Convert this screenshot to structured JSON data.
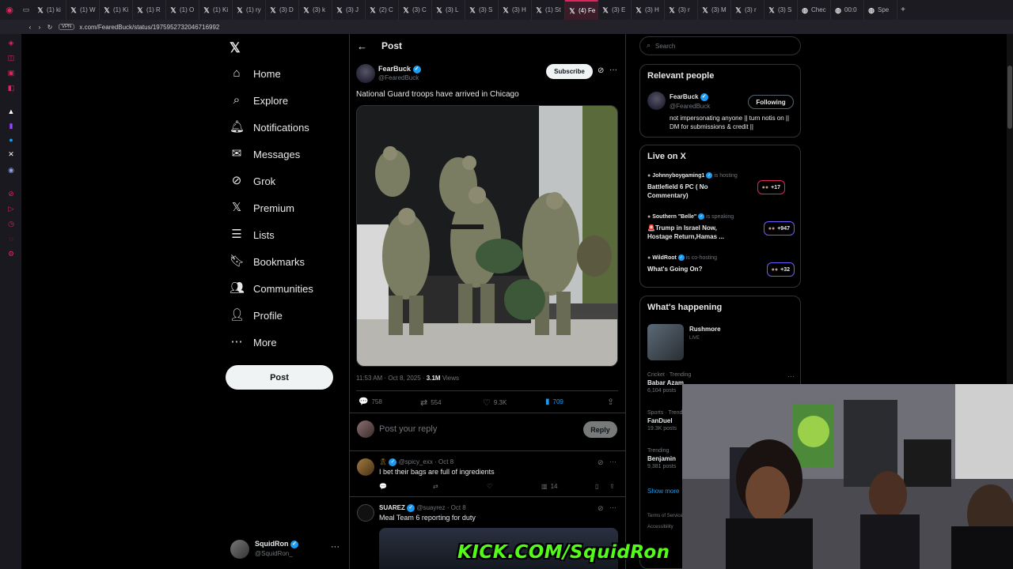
{
  "browser": {
    "tabs": [
      {
        "label": "(1) ki"
      },
      {
        "label": "(1) W"
      },
      {
        "label": "(1) Ki"
      },
      {
        "label": "(1) R"
      },
      {
        "label": "(1) O"
      },
      {
        "label": "(1) Ki"
      },
      {
        "label": "(1) ry"
      },
      {
        "label": "(3) D"
      },
      {
        "label": "(3) k"
      },
      {
        "label": "(3) J"
      },
      {
        "label": "(2) C"
      },
      {
        "label": "(3) C"
      },
      {
        "label": "(3) L"
      },
      {
        "label": "(3) S"
      },
      {
        "label": "(3) H"
      },
      {
        "label": "(1) St"
      },
      {
        "label": "(4) Fe"
      },
      {
        "label": "(3) E"
      },
      {
        "label": "(3) H"
      },
      {
        "label": "(3) r"
      },
      {
        "label": "(3) M"
      },
      {
        "label": "(3) r"
      },
      {
        "label": "(3) S"
      },
      {
        "label": "Chec"
      },
      {
        "label": "00:0"
      },
      {
        "label": "Spe"
      }
    ],
    "url": "x.com/FearedBuck/status/1975952732046716992",
    "vpn_label": "VPN"
  },
  "nav": {
    "items": [
      {
        "label": "Home",
        "icon": "home-icon"
      },
      {
        "label": "Explore",
        "icon": "search-icon"
      },
      {
        "label": "Notifications",
        "icon": "bell-icon"
      },
      {
        "label": "Messages",
        "icon": "mail-icon"
      },
      {
        "label": "Grok",
        "icon": "grok-icon"
      },
      {
        "label": "Premium",
        "icon": "x-logo-icon"
      },
      {
        "label": "Lists",
        "icon": "list-icon"
      },
      {
        "label": "Bookmarks",
        "icon": "bookmark-icon"
      },
      {
        "label": "Communities",
        "icon": "communities-icon"
      },
      {
        "label": "Profile",
        "icon": "person-icon"
      },
      {
        "label": "More",
        "icon": "more-circle-icon"
      }
    ],
    "post_button": "Post",
    "account": {
      "name": "SquidRon",
      "handle": "@SquidRon_"
    }
  },
  "main": {
    "header_title": "Post",
    "post": {
      "author": "FearBuck",
      "handle": "@FearedBuck",
      "subscribe": "Subscribe",
      "text": "National Guard troops have arrived in Chicago",
      "time": "11:53 AM · Oct 8, 2025 ·",
      "views_count": "3.1M",
      "views_label": "Views",
      "replies": "758",
      "reposts": "554",
      "likes": "9.3K",
      "bookmarks": "709"
    },
    "reply_placeholder": "Post your reply",
    "reply_button": "Reply",
    "replies": [
      {
        "handle": "@spicy_exx · Oct 8",
        "text": "I bet their bags are full of ingredients",
        "views": "14"
      },
      {
        "name": "SUAREZ",
        "handle": "@suayrez · Oct 8",
        "text": "Meal Team 6 reporting for duty"
      }
    ]
  },
  "right": {
    "search_placeholder": "Search",
    "relevant": {
      "title": "Relevant people",
      "name": "FearBuck",
      "handle": "@FearedBuck",
      "follow": "Following",
      "bio": "not impersonating anyone || turn notis on || DM for submissions & credit ||"
    },
    "live": {
      "title": "Live on X",
      "items": [
        {
          "host": "Johnnyboygaming1",
          "status": "is hosting",
          "title": "Battlefield 6 PC ( No Commentary)",
          "count": "+17"
        },
        {
          "host": "Southern \"Belle\"",
          "status": "is speaking",
          "title": "🚨Trump in Israel Now, Hostage Return,Hamas ...",
          "count": "+947"
        },
        {
          "host": "WildRoot",
          "status": "is co-hosting",
          "title": "What's Going On?",
          "count": "+32"
        }
      ]
    },
    "happening": {
      "title": "What's happening",
      "featured": {
        "title": "Rushmore",
        "sub": "LIVE"
      },
      "trends": [
        {
          "cat": "Cricket · Trending",
          "name": "Babar Azam",
          "posts": "6,104 posts"
        },
        {
          "cat": "Sports · Trending",
          "name": "FanDuel",
          "posts": "19.3K posts"
        },
        {
          "cat": "Trending",
          "name": "Benjamin",
          "posts": "9,381 posts"
        }
      ],
      "show_more": "Show more"
    },
    "footer": [
      "Terms of Service",
      "Accessibility"
    ]
  },
  "overlay": {
    "banner": "KICK.COM/SquidRon"
  },
  "colors": {
    "accent": "#1d9bf0",
    "bg": "#000000",
    "border": "#2f3336",
    "muted": "#71767b",
    "kick": "#53fc18"
  }
}
